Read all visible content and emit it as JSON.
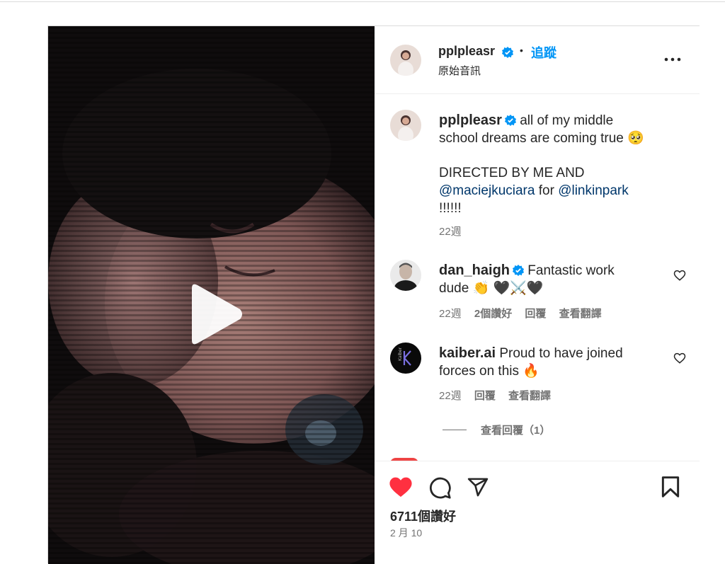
{
  "post": {
    "author": "pplpleasr",
    "follow_label": "追蹤",
    "dot": "•",
    "audio_label": "原始音訊",
    "caption_line1": "all of my middle",
    "caption_line2": "school dreams are coming true 🥺",
    "caption_line3": "DIRECTED BY ME AND",
    "caption_mention1": "@maciejkuciara",
    "caption_for": " for ",
    "caption_mention2": "@linkinpark",
    "caption_line5": "!!!!!!",
    "caption_time": "22週"
  },
  "comments": [
    {
      "user": "dan_haigh",
      "text1": "Fantastic work",
      "text2": "dude 👏 🖤⚔️🖤",
      "time": "22週",
      "likes": "2個讚好",
      "reply": "回覆",
      "translate": "查看翻譯"
    },
    {
      "user": "kaiber.ai",
      "text1": "Proud to have joined",
      "text2": "forces on this 🔥",
      "time": "22週",
      "reply": "回覆",
      "translate": "查看翻譯",
      "view_replies": "查看回覆（1）"
    }
  ],
  "footer": {
    "likes_count": "6711個讚好",
    "date": "2 月 10"
  },
  "colors": {
    "accent": "#0095f6",
    "like_red": "#ff3040",
    "verified_blue": "#0095f6",
    "mention": "#00376b"
  },
  "icons": [
    "play-icon",
    "verified-icon",
    "more-icon",
    "heart-icon",
    "comment-icon",
    "share-icon",
    "bookmark-icon"
  ]
}
